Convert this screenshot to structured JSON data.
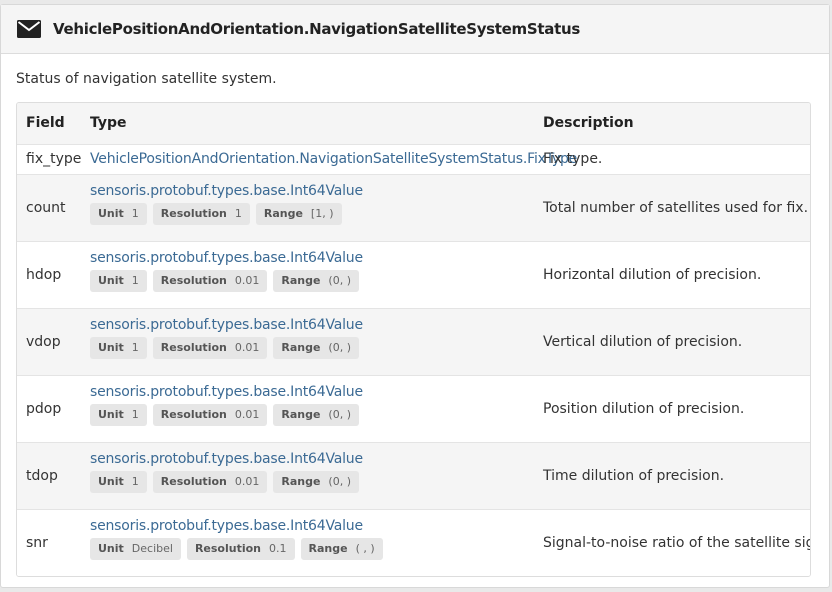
{
  "header": {
    "icon": "envelope-icon",
    "title": "VehiclePositionAndOrientation.NavigationSatelliteSystemStatus"
  },
  "description": "Status of navigation satellite system.",
  "table": {
    "headers": {
      "field": "Field",
      "type": "Type",
      "description": "Description"
    },
    "rows": [
      {
        "field": "fix_type",
        "type": "VehiclePositionAndOrientation.NavigationSatelliteSystemStatus.FixType",
        "description": "Fix type.",
        "badges": []
      },
      {
        "field": "count",
        "type": "sensoris.protobuf.types.base.Int64Value",
        "description": "Total number of satellites used for fix.",
        "badges": [
          {
            "key": "Unit",
            "value": "1"
          },
          {
            "key": "Resolution",
            "value": "1"
          },
          {
            "key": "Range",
            "value": "[1, )"
          }
        ]
      },
      {
        "field": "hdop",
        "type": "sensoris.protobuf.types.base.Int64Value",
        "description": "Horizontal dilution of precision.",
        "badges": [
          {
            "key": "Unit",
            "value": "1"
          },
          {
            "key": "Resolution",
            "value": "0.01"
          },
          {
            "key": "Range",
            "value": "(0, )"
          }
        ]
      },
      {
        "field": "vdop",
        "type": "sensoris.protobuf.types.base.Int64Value",
        "description": "Vertical dilution of precision.",
        "badges": [
          {
            "key": "Unit",
            "value": "1"
          },
          {
            "key": "Resolution",
            "value": "0.01"
          },
          {
            "key": "Range",
            "value": "(0, )"
          }
        ]
      },
      {
        "field": "pdop",
        "type": "sensoris.protobuf.types.base.Int64Value",
        "description": "Position dilution of precision.",
        "badges": [
          {
            "key": "Unit",
            "value": "1"
          },
          {
            "key": "Resolution",
            "value": "0.01"
          },
          {
            "key": "Range",
            "value": "(0, )"
          }
        ]
      },
      {
        "field": "tdop",
        "type": "sensoris.protobuf.types.base.Int64Value",
        "description": "Time dilution of precision.",
        "badges": [
          {
            "key": "Unit",
            "value": "1"
          },
          {
            "key": "Resolution",
            "value": "0.01"
          },
          {
            "key": "Range",
            "value": "(0, )"
          }
        ]
      },
      {
        "field": "snr",
        "type": "sensoris.protobuf.types.base.Int64Value",
        "description": "Signal-to-noise ratio of the satellite signal.",
        "badges": [
          {
            "key": "Unit",
            "value": "Decibel"
          },
          {
            "key": "Resolution",
            "value": "0.1"
          },
          {
            "key": "Range",
            "value": "( , )"
          }
        ]
      }
    ]
  },
  "colors": {
    "link": "#3b6a94",
    "header_bg": "#f5f5f5",
    "stripe": "#f5f5f5",
    "badge_bg": "#e6e6e6"
  }
}
